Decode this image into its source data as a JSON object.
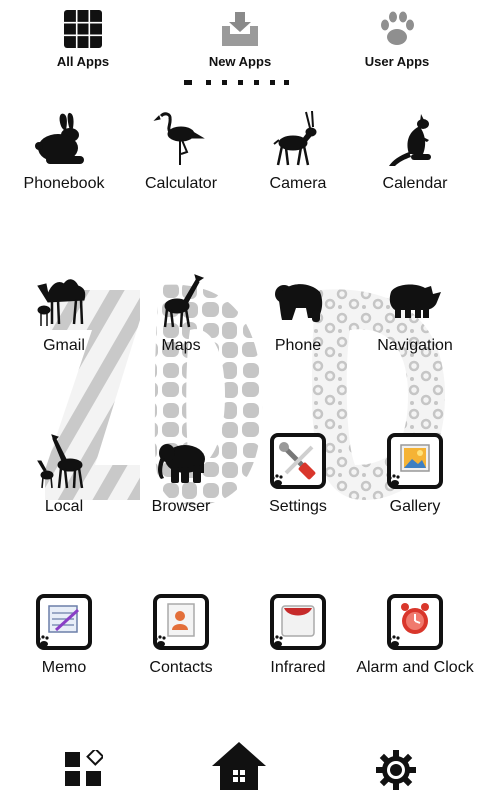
{
  "tabs": [
    {
      "label": "All Apps",
      "icon": "grid-icon"
    },
    {
      "label": "New Apps",
      "icon": "download-tray-icon"
    },
    {
      "label": "User Apps",
      "icon": "paw-print-icon"
    }
  ],
  "page_indicator": {
    "current": 1,
    "count": 7
  },
  "rows": [
    [
      {
        "label": "Phonebook",
        "icon": "rabbit-icon"
      },
      {
        "label": "Calculator",
        "icon": "flamingo-icon"
      },
      {
        "label": "Camera",
        "icon": "antelope-icon"
      },
      {
        "label": "Calendar",
        "icon": "kangaroo-icon"
      }
    ],
    [
      {
        "label": "Gmail",
        "icon": "camel-icon"
      },
      {
        "label": "Maps",
        "icon": "giraffe-icon"
      },
      {
        "label": "Phone",
        "icon": "gorilla-icon"
      },
      {
        "label": "Navigation",
        "icon": "rhino-icon"
      }
    ],
    [
      {
        "label": "Local",
        "icon": "giraffes-icon"
      },
      {
        "label": "Browser",
        "icon": "elephant-icon"
      },
      {
        "label": "Settings",
        "icon": "tools-icon"
      },
      {
        "label": "Gallery",
        "icon": "picture-icon"
      }
    ],
    [
      {
        "label": "Memo",
        "icon": "notepad-icon"
      },
      {
        "label": "Contacts",
        "icon": "contact-card-icon"
      },
      {
        "label": "Infrared",
        "icon": "infrared-icon"
      },
      {
        "label": "Alarm and Clock",
        "icon": "alarm-clock-icon"
      }
    ]
  ],
  "dock": [
    {
      "icon": "widgets-icon"
    },
    {
      "icon": "home-icon"
    },
    {
      "icon": "gear-icon"
    }
  ],
  "colors": {
    "ink": "#111111",
    "pattern": "#c8c8c8",
    "accent_red": "#d9362b"
  }
}
